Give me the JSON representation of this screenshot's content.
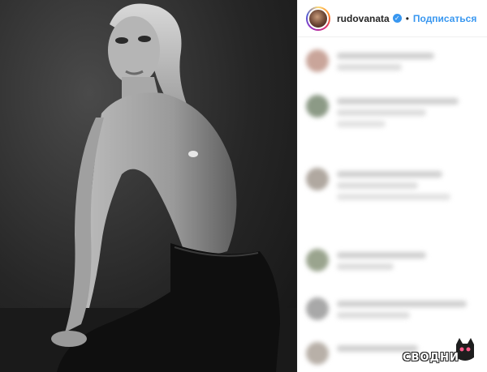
{
  "post": {
    "username": "rudovanata",
    "follow_label": "Подписаться",
    "separator": "•",
    "verified_icon": "verified-badge-icon",
    "verified_glyph": "✓"
  },
  "colors": {
    "accent": "#3897f0",
    "text": "#262626"
  },
  "watermark": {
    "text": "СВОДНИ"
  }
}
